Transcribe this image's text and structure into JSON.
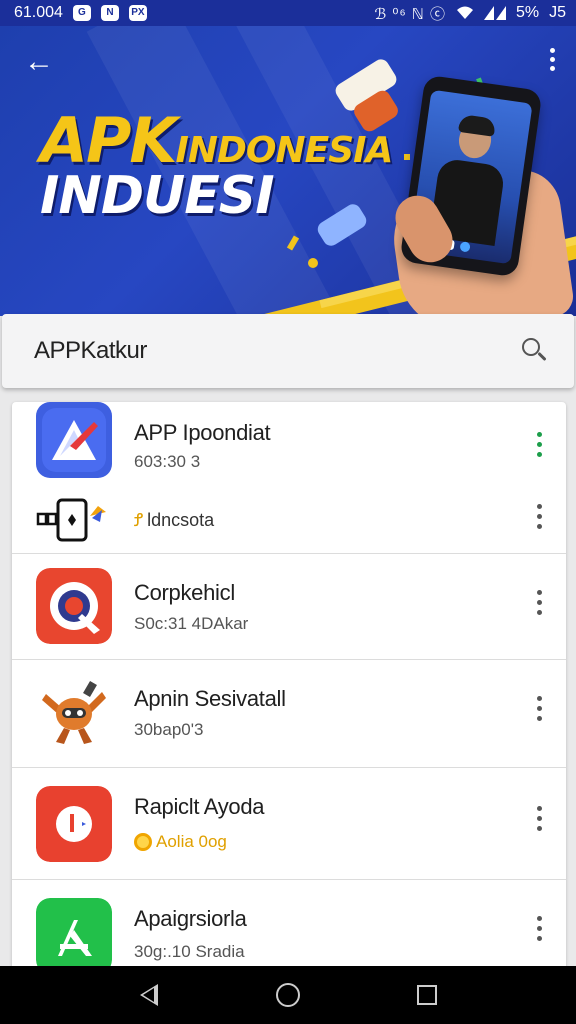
{
  "status_bar": {
    "time": "61.004",
    "left_icons": [
      "g-icon",
      "n-icon",
      "px-icon"
    ],
    "right_glyphs": "ℬ ⁰⁶ ℕ ⓒ",
    "battery": "5%",
    "extra": "J5"
  },
  "hero": {
    "title_apk": "APK",
    "title_indonesia": "INDONESIA",
    "title_line2": "INDUESI",
    "colors": {
      "accent": "#f5c518",
      "background": "#2747c2"
    }
  },
  "search": {
    "value": "APPKatkur"
  },
  "apps": [
    {
      "name": "APP Ipoondiat",
      "subtitle": "603:30 3",
      "icon": "app-store-arrow-icon",
      "icon_color": "#3b5bdb",
      "menu_color": "#1c9e4a"
    },
    {
      "name": "Corpkehicl",
      "subtitle": "S0c:31 4DAkar",
      "icon": "q-logo-icon",
      "icon_color": "#e8462f"
    },
    {
      "name": "Apnin Sesivatall",
      "subtitle": "30bap0'3",
      "icon": "robot-character-icon",
      "icon_color": "#ffffff"
    },
    {
      "name": "Rapiclt Ayoda",
      "subtitle": "Aolia 0og",
      "icon": "l-logo-icon",
      "icon_color": "#e8462f"
    },
    {
      "name": "Apaigrsiorla",
      "subtitle": "30g:.10 Sradia",
      "icon": "appstore-a-icon",
      "icon_color": "#22c04a"
    }
  ],
  "sub_entry": {
    "label": "ldncsota",
    "icon": "phone-device-icon"
  }
}
